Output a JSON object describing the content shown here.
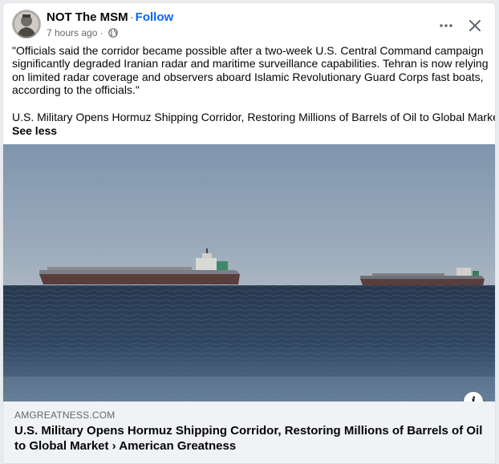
{
  "post": {
    "author": "NOT The MSM",
    "separator": "·",
    "follow_label": "Follow",
    "time_label": "7 hours ago",
    "time_separator": "·",
    "quote_text": "\"Officials said the corridor became possible after a two-week U.S. Central Command campaign significantly degraded Iranian radar and maritime surveillance capabilities. Tehran is now relying on limited radar coverage and observers aboard Islamic Revolutionary Guard Corps fast boats, according to the officials.\"",
    "headline_text": "U.S. Military Opens Hormuz Shipping Corridor, Restoring Millions of Barrels of Oil to Global Market",
    "see_less_label": "See less"
  },
  "header_actions": {
    "more_icon": "more-horizontal-icon",
    "close_icon": "close-icon"
  },
  "link_preview": {
    "domain": "AMGREATNESS.COM",
    "title": "U.S. Military Opens Hormuz Shipping Corridor, Restoring Millions of Barrels of Oil to Global Market › American Greatness",
    "info_icon": "info-icon",
    "info_glyph": "i"
  },
  "colors": {
    "link_blue": "#0866ff",
    "secondary_text": "#65676b",
    "preview_bg": "#f0f2f5"
  }
}
